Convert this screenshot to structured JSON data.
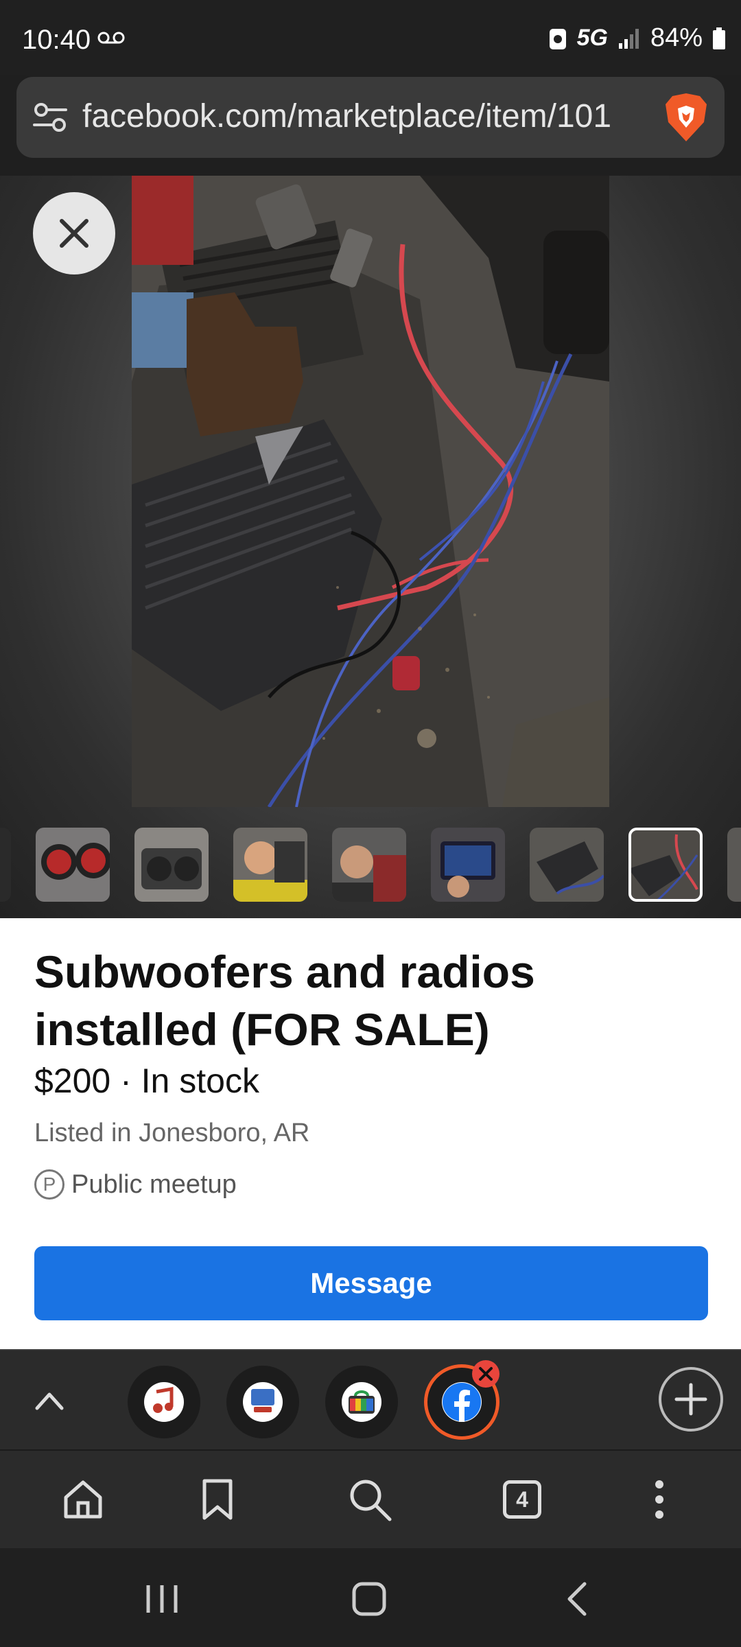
{
  "status": {
    "time": "10:40",
    "network": "5G",
    "battery": "84%"
  },
  "browser": {
    "url": "facebook.com/marketplace/item/101"
  },
  "listing": {
    "title": "Subwoofers and radios installed (FOR SALE)",
    "price_line": "$200 · In stock",
    "location": "Listed in Jonesboro, AR",
    "meetup_icon_letter": "P",
    "meetup": "Public meetup",
    "message_button": "Message"
  },
  "tabs": {
    "count": "4"
  },
  "colors": {
    "accent": "#1a73e3",
    "brave_orange": "#f05a28",
    "close_badge": "#e8453c"
  }
}
